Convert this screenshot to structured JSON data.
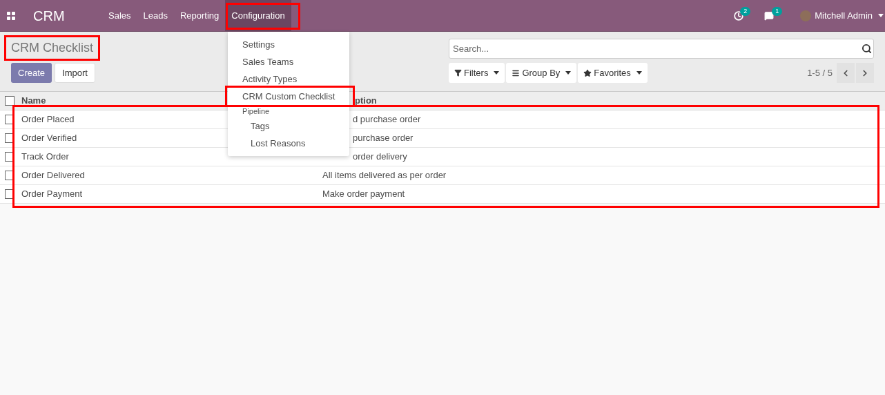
{
  "navbar": {
    "app_name": "CRM",
    "menu": [
      {
        "label": "Sales",
        "selected": false
      },
      {
        "label": "Leads",
        "selected": false
      },
      {
        "label": "Reporting",
        "selected": false
      },
      {
        "label": "Configuration",
        "selected": true
      }
    ],
    "activity_count": "2",
    "message_count": "1",
    "user": "Mitchell Admin"
  },
  "dropdown": {
    "items": [
      {
        "kind": "item",
        "label": "Settings",
        "highlighted": false
      },
      {
        "kind": "item",
        "label": "Sales Teams",
        "highlighted": false
      },
      {
        "kind": "item",
        "label": "Activity Types",
        "highlighted": false
      },
      {
        "kind": "item",
        "label": "CRM Custom Checklist",
        "highlighted": true
      },
      {
        "kind": "header",
        "label": "Pipeline"
      },
      {
        "kind": "subitem",
        "label": "Tags"
      },
      {
        "kind": "subitem",
        "label": "Lost Reasons"
      }
    ]
  },
  "breadcrumb": "CRM Checklist",
  "buttons": [
    "Create",
    "Import"
  ],
  "search": {
    "placeholder": "Search..."
  },
  "filters": [
    "Filters",
    "Group By",
    "Favorites"
  ],
  "pager": "1-5 / 5",
  "table": {
    "select_all_checked": false,
    "columns": [
      "Name",
      "ption"
    ],
    "rows": [
      {
        "name": "Order Placed",
        "description": "d purchase order",
        "checked": false
      },
      {
        "name": "Order Verified",
        "description": "purchase order",
        "checked": false
      },
      {
        "name": "Track Order",
        "description": "order delivery",
        "checked": false
      },
      {
        "name": "Order Delivered",
        "description": "All items delivered as per order",
        "checked": false
      },
      {
        "name": "Order Payment",
        "description": "Make order payment",
        "checked": false
      }
    ]
  }
}
